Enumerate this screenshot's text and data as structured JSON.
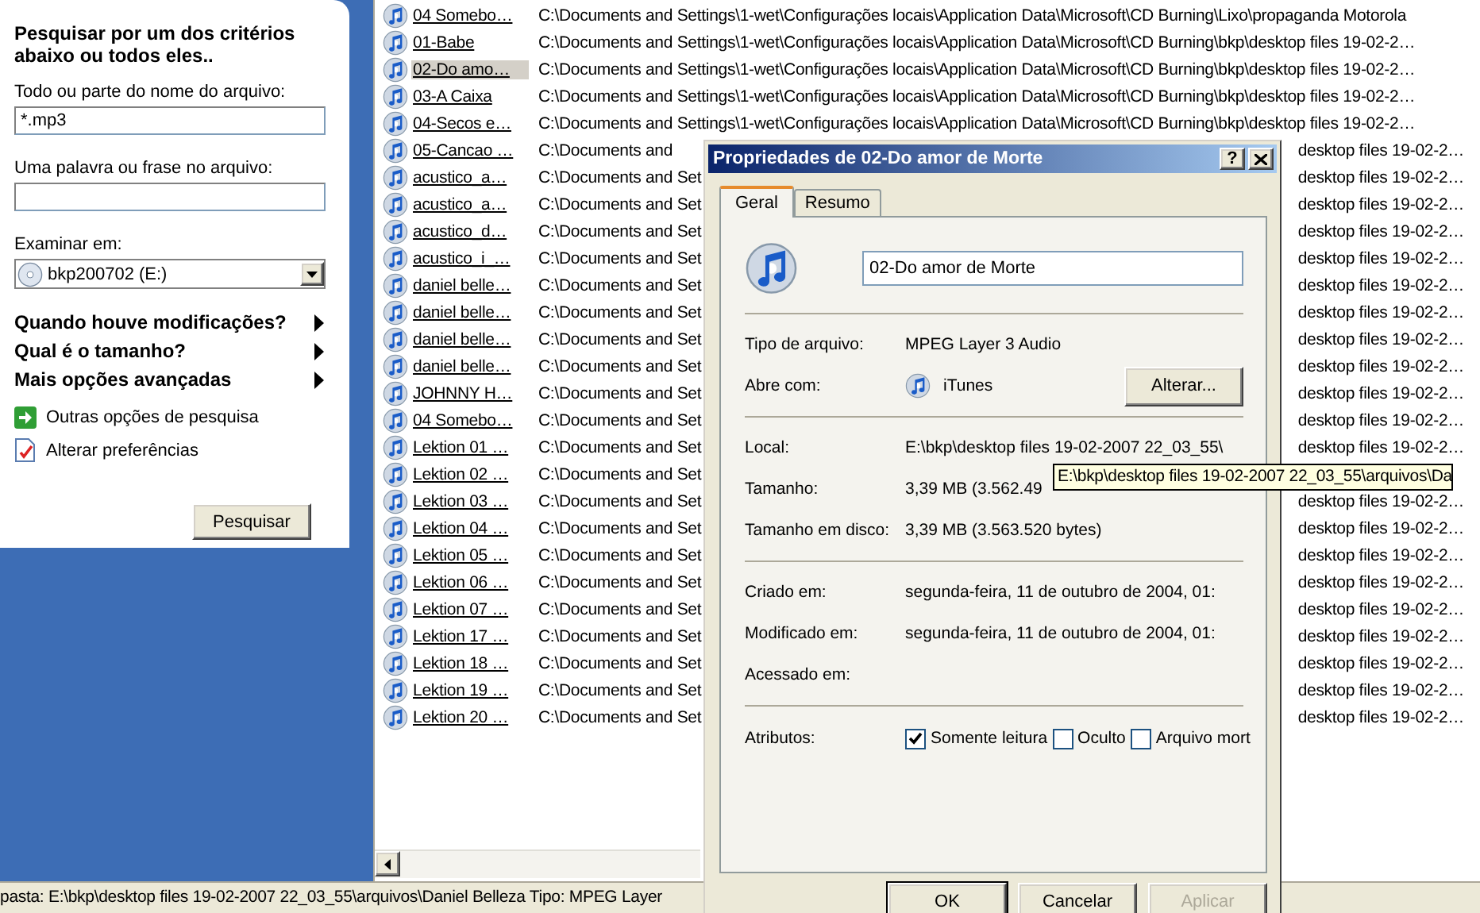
{
  "search_pane": {
    "heading": "Pesquisar por um dos critérios abaixo ou todos eles..",
    "name_label": "Todo ou parte do nome do arquivo:",
    "name_value": "*.mp3",
    "phrase_label": "Uma palavra ou frase no arquivo:",
    "look_in_label": "Examinar em:",
    "look_in_value": "bkp200702 (E:)",
    "expanders": [
      {
        "label": "Quando houve modificações?",
        "expanded": false
      },
      {
        "label": "Qual é o tamanho?",
        "expanded": false
      },
      {
        "label": "Mais opções avançadas",
        "expanded": false
      }
    ],
    "links": [
      {
        "label": "Outras opções de pesquisa",
        "kind": "arrow"
      },
      {
        "label": "Alterar preferências",
        "kind": "prefs"
      }
    ],
    "search_button": "Pesquisar"
  },
  "files": {
    "rows": [
      {
        "name": "04 Somebo…",
        "selected": false,
        "path": "C:\\Documents and Settings\\1-wet\\Configurações locais\\Application Data\\Microsoft\\CD Burning\\Lixo\\propaganda Motorola"
      },
      {
        "name": "01-Babe",
        "selected": false,
        "path": "C:\\Documents and Settings\\1-wet\\Configurações locais\\Application Data\\Microsoft\\CD Burning\\bkp\\desktop files 19-02-2…"
      },
      {
        "name": "02-Do amo…",
        "selected": true,
        "path": "C:\\Documents and Settings\\1-wet\\Configurações locais\\Application Data\\Microsoft\\CD Burning\\bkp\\desktop files 19-02-2…"
      },
      {
        "name": "03-A Caixa",
        "selected": false,
        "path": "C:\\Documents and Settings\\1-wet\\Configurações locais\\Application Data\\Microsoft\\CD Burning\\bkp\\desktop files 19-02-2…"
      },
      {
        "name": "04-Secos e…",
        "selected": false,
        "path": "C:\\Documents and Settings\\1-wet\\Configurações locais\\Application Data\\Microsoft\\CD Burning\\bkp\\desktop files 19-02-2…"
      },
      {
        "name": "05-Cancao …",
        "selected": false,
        "path_left": "C:\\Documents and",
        "path_right": "desktop files 19-02-2…"
      },
      {
        "name": "acustico_a…",
        "selected": false,
        "path_left": "C:\\Documents and Set",
        "path_right": "desktop files 19-02-2…"
      },
      {
        "name": "acustico_a…",
        "selected": false,
        "path_left": "C:\\Documents and Set",
        "path_right": "desktop files 19-02-2…"
      },
      {
        "name": "acustico_d…",
        "selected": false,
        "path_left": "C:\\Documents and Set",
        "path_right": "desktop files 19-02-2…"
      },
      {
        "name": "acustico_i_…",
        "selected": false,
        "path_left": "C:\\Documents and Set",
        "path_right": "desktop files 19-02-2…"
      },
      {
        "name": "daniel belle…",
        "selected": false,
        "path_left": "C:\\Documents and Set",
        "path_right": "desktop files 19-02-2…"
      },
      {
        "name": "daniel belle…",
        "selected": false,
        "path_left": "C:\\Documents and Set",
        "path_right": "desktop files 19-02-2…"
      },
      {
        "name": "daniel belle…",
        "selected": false,
        "path_left": "C:\\Documents and Set",
        "path_right": "desktop files 19-02-2…"
      },
      {
        "name": "daniel belle…",
        "selected": false,
        "path_left": "C:\\Documents and Set",
        "path_right": "desktop files 19-02-2…"
      },
      {
        "name": "JOHNNY H…",
        "selected": false,
        "path_left": "C:\\Documents and Set",
        "path_right": "desktop files 19-02-2…"
      },
      {
        "name": "04 Somebo…",
        "selected": false,
        "path_left": "C:\\Documents and Set",
        "path_right": "desktop files 19-02-2…"
      },
      {
        "name": "Lektion 01 …",
        "selected": false,
        "path_left": "C:\\Documents and Set",
        "path_right": "desktop files 19-02-2…"
      },
      {
        "name": "Lektion 02 …",
        "selected": false,
        "path_left": "C:\\Documents and Set"
      },
      {
        "name": "Lektion 03 …",
        "selected": false,
        "path_left": "C:\\Documents and Set",
        "path_right": "desktop files 19-02-2…"
      },
      {
        "name": "Lektion 04 …",
        "selected": false,
        "path_left": "C:\\Documents and Set",
        "path_right": "desktop files 19-02-2…"
      },
      {
        "name": "Lektion 05 …",
        "selected": false,
        "path_left": "C:\\Documents and Set",
        "path_right": "desktop files 19-02-2…"
      },
      {
        "name": "Lektion 06 …",
        "selected": false,
        "path_left": "C:\\Documents and Set",
        "path_right": "desktop files 19-02-2…"
      },
      {
        "name": "Lektion 07 …",
        "selected": false,
        "path_left": "C:\\Documents and Set",
        "path_right": "desktop files 19-02-2…"
      },
      {
        "name": "Lektion 17 …",
        "selected": false,
        "path_left": "C:\\Documents and Set",
        "path_right": "desktop files 19-02-2…"
      },
      {
        "name": "Lektion 18 …",
        "selected": false,
        "path_left": "C:\\Documents and Set",
        "path_right": "desktop files 19-02-2…"
      },
      {
        "name": "Lektion 19 …",
        "selected": false,
        "path_left": "C:\\Documents and Set",
        "path_right": "desktop files 19-02-2…"
      },
      {
        "name": "Lektion 20 …",
        "selected": false,
        "path_left": "C:\\Documents and Set",
        "path_right": "desktop files 19-02-2…"
      }
    ]
  },
  "status_bar": {
    "text": "pasta: E:\\bkp\\desktop files 19-02-2007 22_03_55\\arquivos\\Daniel Belleza Tipo: MPEG Layer"
  },
  "dialog": {
    "title": "Propriedades de 02-Do amor de Morte",
    "help_button": "?",
    "tabs": [
      {
        "label": "Geral",
        "selected": true
      },
      {
        "label": "Resumo",
        "selected": false
      }
    ],
    "file_name": "02-Do amor de Morte",
    "sections": [
      {
        "rows": [
          {
            "label": "Tipo de arquivo:",
            "value": "MPEG Layer 3 Audio"
          },
          {
            "label": "Abre com:",
            "value": "iTunes",
            "kind": "app",
            "button": "Alterar..."
          }
        ]
      },
      {
        "rows": [
          {
            "label": "Local:",
            "value": "E:\\bkp\\desktop files 19-02-2007 22_03_55\\"
          },
          {
            "label": "Tamanho:",
            "value": "3,39 MB (3.562.49"
          },
          {
            "label": "Tamanho em disco:",
            "value": "3,39 MB (3.563.520 bytes)"
          }
        ]
      },
      {
        "rows": [
          {
            "label": "Criado em:",
            "value": "segunda-feira, 11 de outubro de 2004, 01:"
          },
          {
            "label": "Modificado em:",
            "value": "segunda-feira, 11 de outubro de 2004, 01:"
          },
          {
            "label": "Acessado em:"
          }
        ]
      }
    ],
    "attributes": {
      "label": "Atributos:",
      "options": [
        {
          "label": "Somente leitura",
          "checked": true
        },
        {
          "label": "Oculto",
          "checked": false
        },
        {
          "label": "Arquivo mort",
          "checked": false
        }
      ]
    },
    "buttons": [
      {
        "label": "OK",
        "default": true,
        "disabled": false
      },
      {
        "label": "Cancelar",
        "default": false,
        "disabled": false
      },
      {
        "label": "Aplicar",
        "default": false,
        "disabled": true
      }
    ]
  },
  "tooltip": {
    "text": "E:\\bkp\\desktop files 19-02-2007 22_03_55\\arquivos\\Da"
  }
}
